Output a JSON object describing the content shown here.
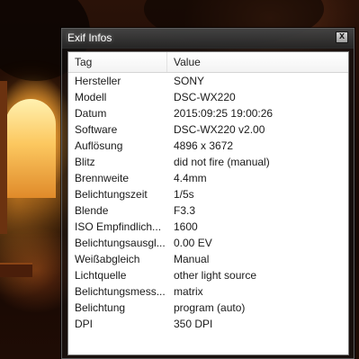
{
  "window": {
    "title": "Exif Infos",
    "close_symbol": "x"
  },
  "table": {
    "columns": [
      "Tag",
      "Value"
    ],
    "rows": [
      {
        "tag": "Hersteller",
        "value": "SONY"
      },
      {
        "tag": "Modell",
        "value": "DSC-WX220"
      },
      {
        "tag": "Datum",
        "value": "2015:09:25 19:00:26"
      },
      {
        "tag": "Software",
        "value": "DSC-WX220 v2.00"
      },
      {
        "tag": "Auflösung",
        "value": "4896 x 3672"
      },
      {
        "tag": "Blitz",
        "value": "did not fire (manual)"
      },
      {
        "tag": "Brennweite",
        "value": "4.4mm"
      },
      {
        "tag": "Belichtungszeit",
        "value": "1/5s"
      },
      {
        "tag": "Blende",
        "value": "F3.3"
      },
      {
        "tag": "ISO Empfindlich...",
        "value": "1600"
      },
      {
        "tag": "Belichtungsausgl...",
        "value": "0.00 EV"
      },
      {
        "tag": "Weißabgleich",
        "value": "Manual"
      },
      {
        "tag": "Lichtquelle",
        "value": "other light source"
      },
      {
        "tag": "Belichtungsmess...",
        "value": "matrix"
      },
      {
        "tag": "Belichtung",
        "value": "program (auto)"
      },
      {
        "tag": "DPI",
        "value": "350 DPI"
      }
    ]
  }
}
